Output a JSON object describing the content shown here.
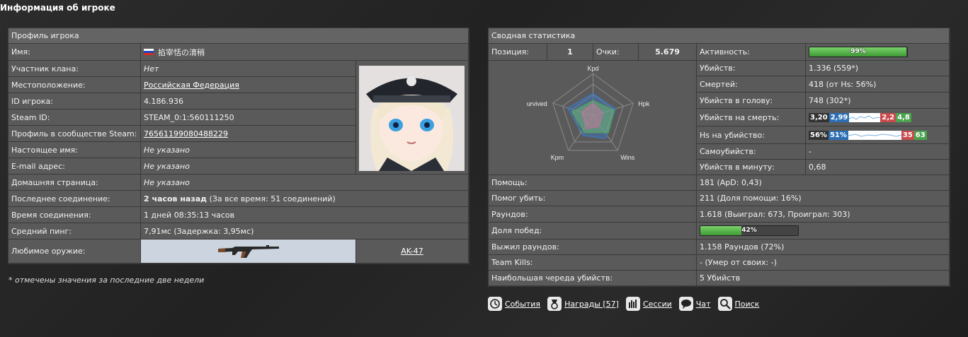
{
  "page_title": "Информация об игроке",
  "profile": {
    "header": "Профиль игрока",
    "rows": [
      {
        "label": "Имя:",
        "value": "掐宰恬の淯稍"
      },
      {
        "label": "Участник клана:",
        "value": "Нет"
      },
      {
        "label": "Местоположение:",
        "value": "Российская Федерация"
      },
      {
        "label": "ID игрока:",
        "value": "4.186.936"
      },
      {
        "label": "Steam ID:",
        "value": "STEAM_0:1:560111250"
      },
      {
        "label": "Профиль в сообществе Steam:",
        "value": "76561199080488229"
      },
      {
        "label": "Настоящее имя:",
        "value": "Не указано"
      },
      {
        "label": "E-mail адрес:",
        "value": "Не указано"
      },
      {
        "label": "Домашняя страница:",
        "value": "Не указано"
      },
      {
        "label": "Последнее соединение:",
        "value_bold": "2 часов назад",
        "value_rest": " (За все время: 51 соединений)"
      },
      {
        "label": "Время соединения:",
        "value": "1 дней 08:35:13 часов"
      },
      {
        "label": "Средний пинг:",
        "value": "7,91мс (Задержка: 3,95мс)"
      },
      {
        "label": "Любимое оружие:",
        "weapon": "AK-47"
      }
    ],
    "note": "* отмечены значения за последние две недели"
  },
  "summary": {
    "header": "Сводная статистика",
    "position_label": "Позиция:",
    "position_value": "1",
    "points_label": "Очки:",
    "points_value": "5.679",
    "radar_labels": [
      "Kpd",
      "Hpk",
      "Wins",
      "Kpm",
      "urvived"
    ],
    "stats": [
      {
        "label": "Активность:",
        "bar_percent": 99,
        "bar_text": "99%"
      },
      {
        "label": "Убийств:",
        "value": "1.336 (559*)"
      },
      {
        "label": "Смертей:",
        "value": "418 (от Hs: 56%)"
      },
      {
        "label": "Убийств в голову:",
        "value": "748 (302*)"
      },
      {
        "label": "Убийств на смерть:",
        "badges": [
          "3,20",
          "2,99",
          "2,2",
          "4,8"
        ]
      },
      {
        "label": "Hs на убийство:",
        "badges": [
          "56%",
          "51%",
          "35",
          "63"
        ]
      },
      {
        "label": "Самоубийств:",
        "value": "-"
      },
      {
        "label": "Убийств в минуту:",
        "value": "0,68"
      }
    ],
    "lower": [
      {
        "label": "Помощь:",
        "value": "181 (ApD: 0,43)"
      },
      {
        "label": "Помог убить:",
        "value": "211 (Доля помощи: 16%)"
      },
      {
        "label": "Раундов:",
        "value": "1.618 (Выиграл: 673, Проиграл: 303)"
      },
      {
        "label": "Доля побед:",
        "bar_percent": 42,
        "bar_text": "42%"
      },
      {
        "label": "Выжил раундов:",
        "value": "1.158 Раундов (72%)"
      },
      {
        "label": "Team Kills:",
        "value": "- (Умер от своих: -)"
      },
      {
        "label": "Наибольшая череда убийств:",
        "value": "5 Убийств"
      }
    ]
  },
  "tabs": [
    {
      "label": "События",
      "icon": "clock-icon"
    },
    {
      "label": "Награды [57]",
      "icon": "medal-icon"
    },
    {
      "label": "Сессии",
      "icon": "bar-chart-icon"
    },
    {
      "label": "Чат",
      "icon": "chat-bubble-icon"
    },
    {
      "label": "Поиск",
      "icon": "magnifier-icon"
    }
  ],
  "colors": {
    "bar_green": "#4aa34d",
    "badge_blue": "#2d6fb5",
    "badge_red": "#c9494c",
    "badge_green": "#4aa34d"
  }
}
